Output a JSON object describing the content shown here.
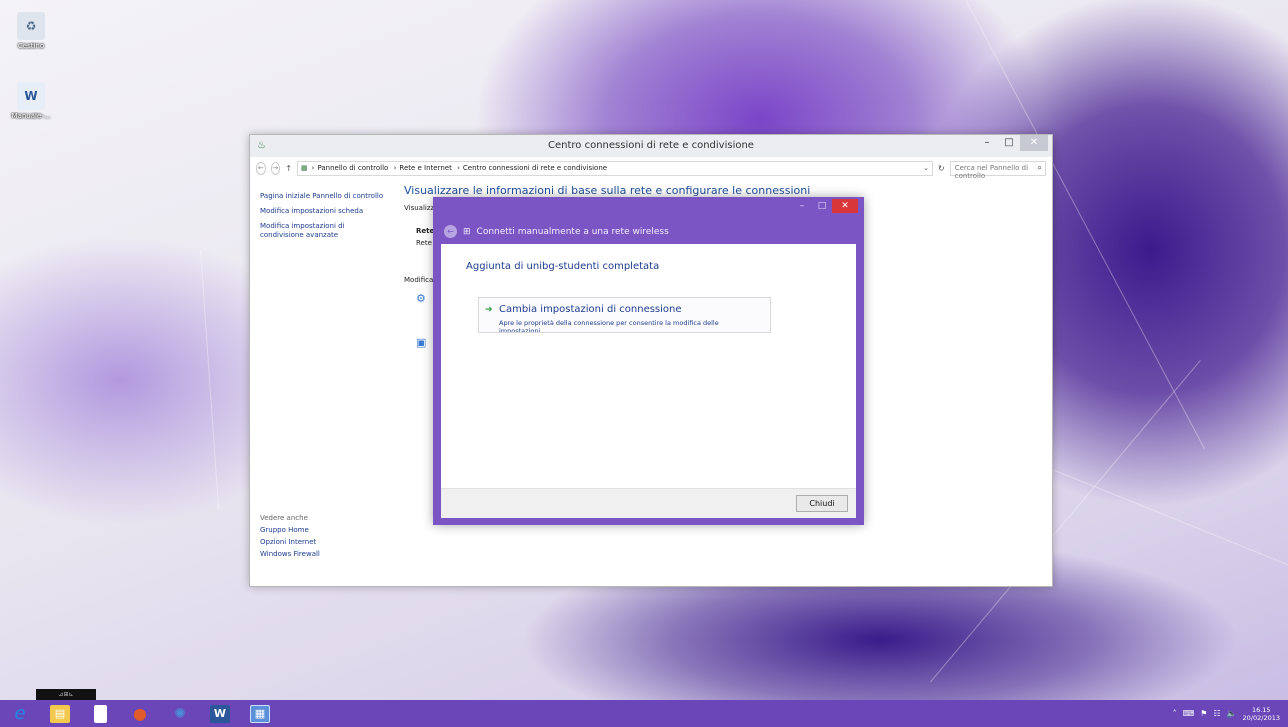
{
  "desktop": {
    "icons": [
      {
        "label": "Cestino",
        "icon": "recycle-bin-icon"
      },
      {
        "label": "Manuale-...",
        "icon": "word-document-icon"
      }
    ]
  },
  "main_window": {
    "title": "Centro connessioni di rete e condivisione",
    "breadcrumbs": [
      "Pannello di controllo",
      "Rete e Internet",
      "Centro connessioni di rete e condivisione"
    ],
    "search_placeholder": "Cerca nel Pannello di controllo",
    "sidebar": {
      "items": [
        "Pagina iniziale Pannello di controllo",
        "Modifica impostazioni scheda",
        "Modifica impostazioni di condivisione avanzate"
      ],
      "see_also_header": "Vedere anche",
      "see_also": [
        "Gruppo Home",
        "Opzioni Internet",
        "Windows Firewall"
      ]
    },
    "content": {
      "title": "Visualizzare le informazioni di base sulla rete e configurare le connessioni",
      "frag_visualizza": "Visualizz",
      "frag_rete": "Rete",
      "frag_rete2": "Rete",
      "frag_modifica": "Modifica"
    }
  },
  "dialog": {
    "title": "Connetti manualmente a una rete wireless",
    "heading": "Aggiunta di unibg-studenti completata",
    "option": {
      "title": "Cambia impostazioni di connessione",
      "description": "Apre le proprietà della connessione per consentire la modifica delle impostazioni."
    },
    "close_button": "Chiudi"
  },
  "taskbar": {
    "thumbnail_label": "⊿⊞⊾",
    "apps": [
      {
        "name": "internet-explorer-icon",
        "glyph": "e",
        "color": "#1e88e5"
      },
      {
        "name": "file-explorer-icon",
        "glyph": "▤",
        "color": "#f2c94c"
      },
      {
        "name": "document-icon",
        "glyph": "▯",
        "color": "#ffffff"
      },
      {
        "name": "paint-icon",
        "glyph": "●",
        "color": "#e05a2b"
      },
      {
        "name": "network-icon",
        "glyph": "✺",
        "color": "#4a90d9"
      },
      {
        "name": "word-icon",
        "glyph": "W",
        "color": "#2b579a"
      },
      {
        "name": "control-panel-icon",
        "glyph": "▦",
        "color": "#5b8fd8"
      }
    ],
    "clock_time": "16.15",
    "clock_date": "20/02/2013"
  }
}
